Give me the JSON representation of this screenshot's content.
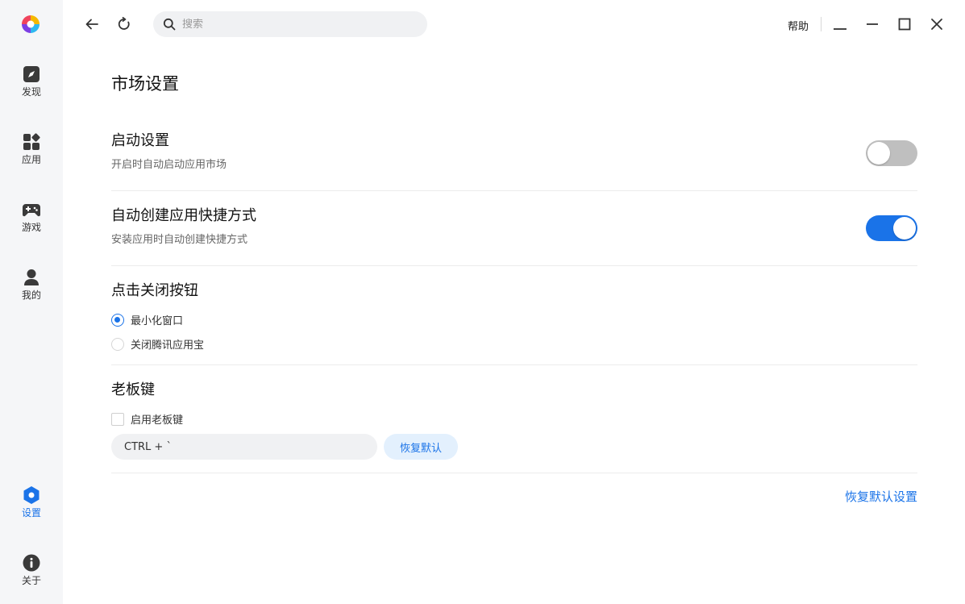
{
  "sidebar": {
    "items": [
      {
        "label": "发现",
        "icon": "discover-icon"
      },
      {
        "label": "应用",
        "icon": "apps-icon"
      },
      {
        "label": "游戏",
        "icon": "gamepad-icon"
      },
      {
        "label": "我的",
        "icon": "user-icon"
      },
      {
        "label": "设置",
        "icon": "settings-icon",
        "active": true
      },
      {
        "label": "关于",
        "icon": "info-icon"
      }
    ]
  },
  "topbar": {
    "search_placeholder": "搜索",
    "help_label": "帮助"
  },
  "page": {
    "title": "市场设置"
  },
  "startup": {
    "title": "启动设置",
    "desc": "开启时自动启动应用市场",
    "enabled": false
  },
  "shortcut": {
    "title": "自动创建应用快捷方式",
    "desc": "安装应用时自动创建快捷方式",
    "enabled": true
  },
  "close_button": {
    "title": "点击关闭按钮",
    "options": [
      "最小化窗口",
      "关闭腾讯应用宝"
    ],
    "selected": 0
  },
  "boss_key": {
    "title": "老板键",
    "checkbox_label": "启用老板键",
    "checked": false,
    "hotkey_value": "CTRL + `",
    "restore_label": "恢复默认"
  },
  "footer": {
    "restore_all_label": "恢复默认设置"
  },
  "colors": {
    "accent": "#1a73e8",
    "sidebar_bg": "#f5f6f8",
    "toggle_off": "#bfbfbf"
  }
}
